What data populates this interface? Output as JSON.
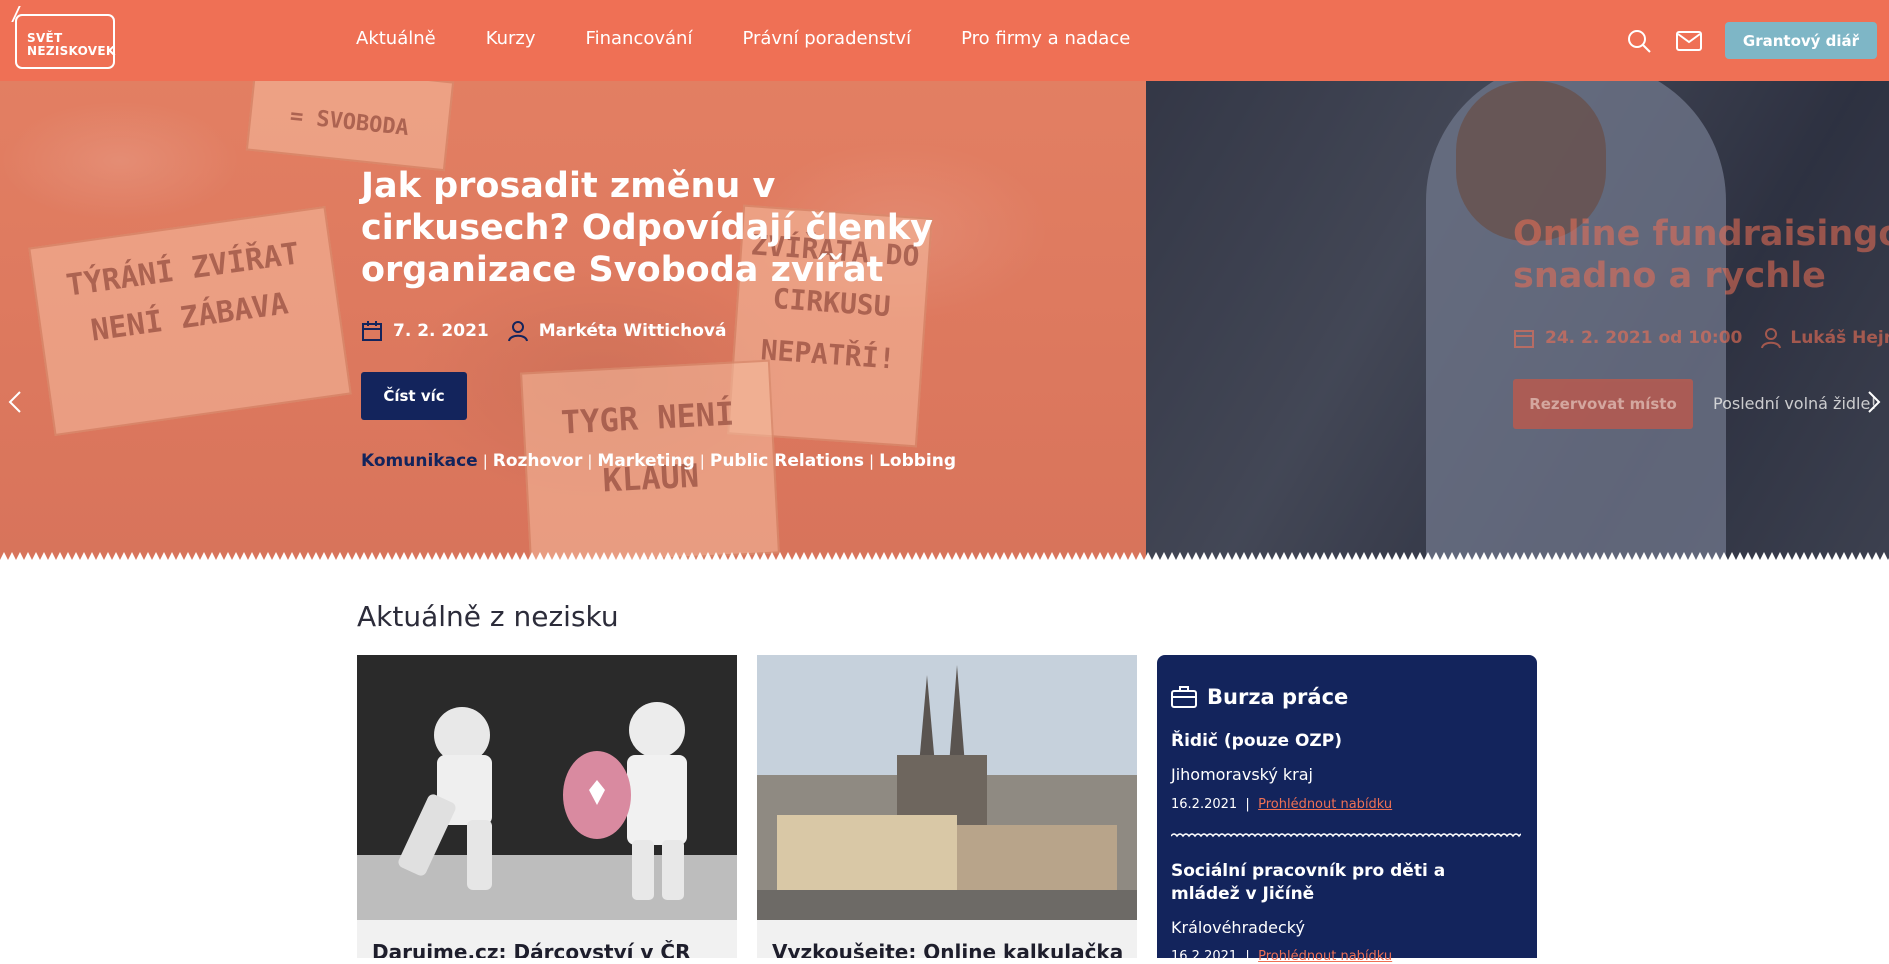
{
  "header": {
    "logo_line1": "SVĚT",
    "logo_line2": "NEZISKOVEK",
    "nav": [
      "Aktuálně",
      "Kurzy",
      "Financování",
      "Právní poradenství",
      "Pro firmy a nadace"
    ],
    "cta_label": "Grantový diář",
    "colors": {
      "brand": "#ef7055",
      "navy": "#13245c",
      "cta": "#7eb6c6"
    }
  },
  "hero": {
    "slide1": {
      "title": "Jak prosadit změnu v cirkusech? Odpovídají členky organizace Svoboda zvířat",
      "date": "7. 2. 2021",
      "author": "Markéta Wittichová",
      "button": "Číst víc",
      "tags": [
        "Komunikace",
        "Rozhovor",
        "Marketing",
        "Public Relations",
        "Lobbing"
      ],
      "signs": [
        "TÝRÁNÍ ZVÍŘAT NENÍ ZÁBAVA",
        "ZVÍŘATA DO CIRKUSU NEPATŘÍ!",
        "TYGR NENÍ KLAUN",
        "= SVOBODA"
      ]
    },
    "slide2": {
      "title_line1": "Online fundraisingový",
      "title_line2": "snadno a rychle",
      "date": "24. 2. 2021 od 10:00",
      "author": "Lukáš Hejna, Jo",
      "button": "Rezervovat místo",
      "note": "Poslední volná židle!"
    }
  },
  "section": {
    "title": "Aktuálně z nezisku",
    "cards": [
      {
        "title": "Darujme.cz: Dárcovství v ČR"
      },
      {
        "title": "Vyzkoušejte: Online kalkulačka"
      }
    ]
  },
  "jobs": {
    "heading": "Burza práce",
    "items": [
      {
        "title": "Řidič (pouze OZP)",
        "region": "Jihomoravský kraj",
        "date": "16.2.2021",
        "link": "Prohlédnout nabídku"
      },
      {
        "title": "Sociální pracovník pro děti a mládež v Jičíně",
        "region": "Královéhradecký",
        "date": "16.2.2021",
        "link": "Prohlédnout nabídku"
      }
    ]
  }
}
